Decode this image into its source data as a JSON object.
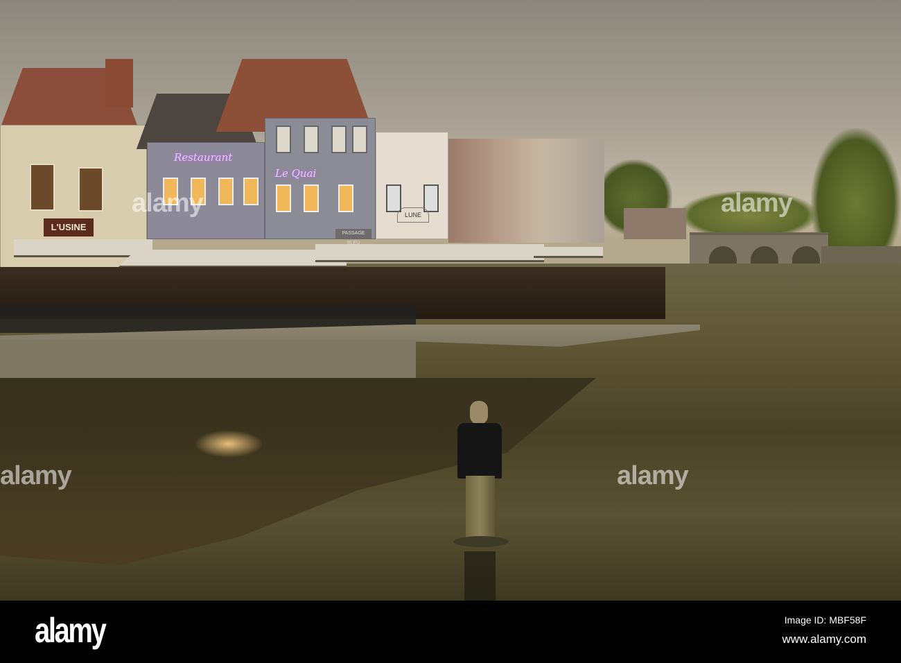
{
  "signs": {
    "usine": "L'USINE",
    "restaurant": "Restaurant",
    "le_quai": "Le Quai",
    "lune": "LUNE",
    "passage_bleu": "PASSAGE BLEU"
  },
  "watermark": "alamy",
  "footer": {
    "logo": "alamy",
    "image_id": "Image ID: MBF58F",
    "url": "www.alamy.com"
  }
}
